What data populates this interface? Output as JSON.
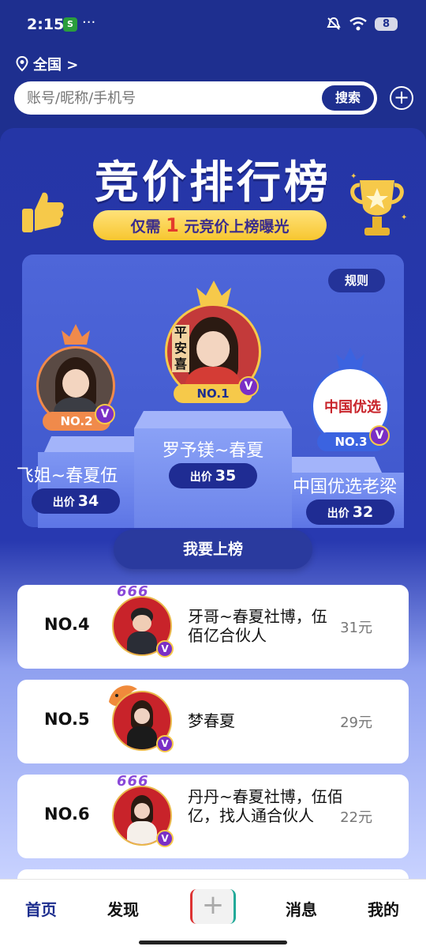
{
  "status": {
    "time": "2:15",
    "app_icon": "S",
    "dots": "···",
    "battery": "8"
  },
  "location": {
    "label": "全国 >"
  },
  "search": {
    "placeholder": "账号/昵称/手机号",
    "button": "搜索"
  },
  "banner": {
    "title": "竞价排行榜",
    "sub_prefix": "仅需",
    "sub_num": "1",
    "sub_suffix": "元竞价上榜曝光",
    "rules": "规则"
  },
  "podium": {
    "first": {
      "rank": "NO.1",
      "name": "罗予镁~春夏",
      "bid_label": "出价",
      "bid": "35",
      "avatar_text": "平安喜"
    },
    "second": {
      "rank": "NO.2",
      "name": "飞姐~春夏伍",
      "bid_label": "出价",
      "bid": "34"
    },
    "third": {
      "rank": "NO.3",
      "name": "中国优选老梁",
      "bid_label": "出价",
      "bid": "32",
      "avatar_text": "中国优选"
    }
  },
  "join_button": "我要上榜",
  "list": [
    {
      "rank": "NO.4",
      "name": "牙哥~春夏社博，伍佰亿合伙人",
      "price": "31元",
      "badge": "666"
    },
    {
      "rank": "NO.5",
      "name": "梦春夏",
      "price": "29元",
      "badge": ""
    },
    {
      "rank": "NO.6",
      "name": "丹丹~春夏社博，伍佰亿，找人通合伙人",
      "price": "22元",
      "badge": "666"
    }
  ],
  "tabs": {
    "home": "首页",
    "discover": "发现",
    "add": "+",
    "messages": "消息",
    "mine": "我的"
  },
  "colors": {
    "brand": "#1e2f8f",
    "gold": "#f6c94a",
    "vip": "#7a2fc6"
  }
}
